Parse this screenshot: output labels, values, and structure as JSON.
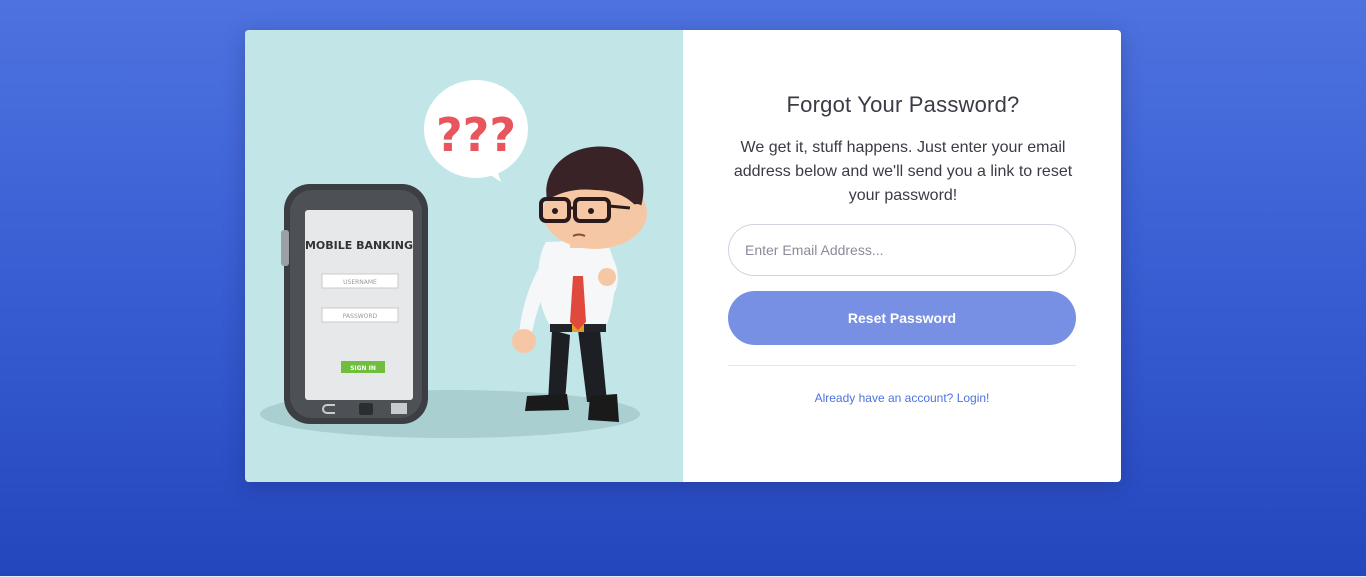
{
  "form": {
    "title": "Forgot Your Password?",
    "description": "We get it, stuff happens. Just enter your email address below and we'll send you a link to reset your password!",
    "email_placeholder": "Enter Email Address...",
    "reset_button_label": "Reset Password",
    "login_link_label": "Already have an account? Login!"
  },
  "illustration": {
    "question_marks": "???",
    "phone_screen_title": "MOBILE BANKING",
    "username_field": "USERNAME",
    "password_field": "PASSWORD",
    "signin_button": "SIGN IN"
  },
  "colors": {
    "background": "#4e73df",
    "button": "#7790e3",
    "link": "#4e73df",
    "illustration_bg": "#c2e6e8"
  }
}
